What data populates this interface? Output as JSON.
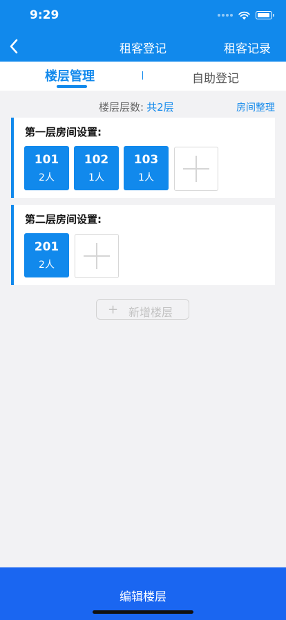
{
  "status_bar": {
    "time": "9:29"
  },
  "nav": {
    "title": "租客登记",
    "right_link": "租客记录"
  },
  "tabs": [
    {
      "label": "楼层管理",
      "active": true
    },
    {
      "label": "自助登记",
      "active": false
    }
  ],
  "summary": {
    "label": "楼层层数:",
    "count": "共2层",
    "action": "房间整理"
  },
  "floors": [
    {
      "title": "第一层房间设置:",
      "rooms": [
        {
          "number": "101",
          "occupants": "2人"
        },
        {
          "number": "102",
          "occupants": "1人"
        },
        {
          "number": "103",
          "occupants": "1人"
        }
      ]
    },
    {
      "title": "第二层房间设置:",
      "rooms": [
        {
          "number": "201",
          "occupants": "2人"
        }
      ]
    }
  ],
  "add_floor": {
    "icon": "+",
    "label": "新增楼层"
  },
  "bottom_button": {
    "label": "编辑楼层"
  },
  "colors": {
    "primary": "#1189ec",
    "bottom_bar": "#1a66f1",
    "background": "#f2f2f4"
  }
}
